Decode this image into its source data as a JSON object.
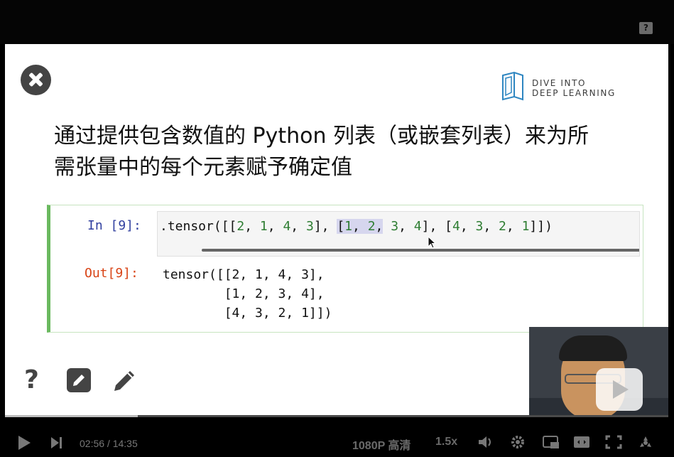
{
  "top_bar": {
    "help_label": "?"
  },
  "slide": {
    "logo": {
      "line1": "DIVE INTO",
      "line2": "DEEP LEARNING"
    },
    "title_line1": "通过提供包含数值的 Python 列表（或嵌套列表）来为所",
    "title_line2": "需张量中的每个元素赋予确定值",
    "cell": {
      "in_prompt": "In [9]:",
      "out_prompt": "Out[9]:",
      "code": ".tensor([[2, 1, 4, 3], [1, 2, 3, 4], [4, 3, 2, 1]])",
      "output_line1": "tensor([[2, 1, 4, 3],",
      "output_line2": "        [1, 2, 3, 4],",
      "output_line3": "        [4, 3, 2, 1]])"
    },
    "bottom_icons": [
      "help-icon",
      "edit-box-icon",
      "pencil-icon"
    ],
    "next_icon": "chevron-right-icon"
  },
  "player": {
    "current_time": "02:56",
    "separator": " / ",
    "duration": "14:35",
    "progress_fraction": 0.2,
    "quality": "1080P 高清",
    "speed": "1.5x",
    "icons": [
      "play-icon",
      "next-track-icon",
      "volume-icon",
      "settings-icon",
      "pip-icon",
      "wide-icon",
      "fullscreen-icon",
      "danmaku-icon"
    ]
  },
  "colors": {
    "accent_blue": "#303f9f",
    "out_red": "#d84315",
    "cell_green": "#6ab95f",
    "number_green": "#2e7d32"
  }
}
